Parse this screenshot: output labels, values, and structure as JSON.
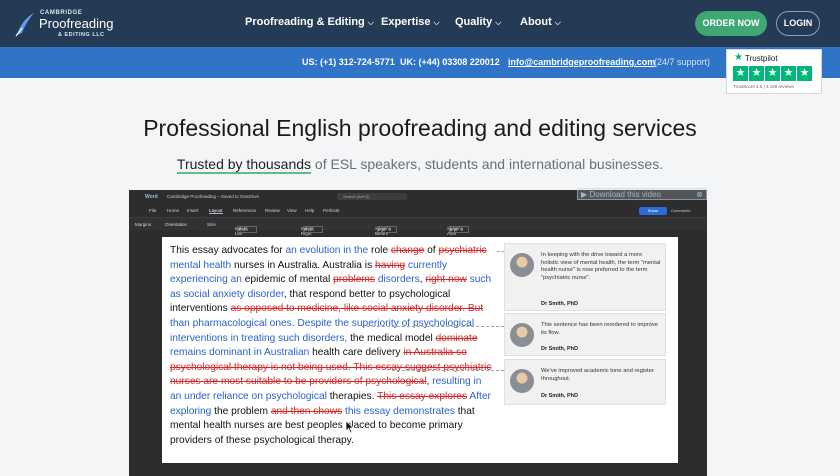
{
  "header": {
    "logo": {
      "top": "CAMBRIDGE",
      "main": "Proofreading",
      "bottom": "& EDITING LLC"
    },
    "nav": [
      {
        "label": "Proofreading & Editing"
      },
      {
        "label": "Expertise"
      },
      {
        "label": "Quality"
      },
      {
        "label": "About"
      }
    ],
    "order_label": "ORDER NOW",
    "login_label": "LOGIN"
  },
  "contact": {
    "us": "US: (+1) 312-724-5771",
    "uk": "UK: (+44) 03308 220012",
    "email": "info@cambridgeproofreading.com",
    "availability": "(24/7 support)"
  },
  "trustpilot": {
    "name": "Trustpilot",
    "score": "TrustScore 4.5 | 3,158 reviews",
    "stars": 5
  },
  "hero": {
    "title": "Professional English proofreading and editing services",
    "subtitle_highlight": "Trusted by thousands",
    "subtitle_rest": " of ESL speakers, students and international businesses."
  },
  "video": {
    "download_label": "Download this video",
    "app": "Word",
    "doc_title": "Cambridge Proofreading – Saved to OneDrive",
    "search_placeholder": "Search (Alt+Q)",
    "menu": [
      "File",
      "Home",
      "Insert",
      "Layout",
      "References",
      "Review",
      "View",
      "Help",
      "Perfectit"
    ],
    "active_menu": "Layout",
    "share_label": "Share",
    "comments_label": "Comments",
    "ribbon": {
      "margins": "Margins",
      "orientation": "Orientation",
      "size": "Size",
      "indent_left": "Indent Left",
      "indent_left_val": "0 cm",
      "indent_right": "Indent Right",
      "indent_right_val": "0 cm",
      "spacing_before": "Spacing Before",
      "spacing_before_val": "0 pt",
      "spacing_after": "Spacing After",
      "spacing_after_val": "8 pt"
    },
    "document": [
      {
        "t": "n",
        "s": "This essay advocates for "
      },
      {
        "t": "i",
        "s": "an evolution in the"
      },
      {
        "t": "n",
        "s": " role "
      },
      {
        "t": "d",
        "s": "change"
      },
      {
        "t": "n",
        "s": " of "
      },
      {
        "t": "d",
        "s": "psychiatric"
      },
      {
        "t": "n",
        "s": " "
      },
      {
        "t": "i",
        "s": "mental health"
      },
      {
        "t": "n",
        "s": " nurses in Australia. Australia is "
      },
      {
        "t": "d",
        "s": "having"
      },
      {
        "t": "n",
        "s": " "
      },
      {
        "t": "i",
        "s": "currently experiencing an"
      },
      {
        "t": "n",
        "s": " epidemic of mental "
      },
      {
        "t": "d",
        "s": "problems"
      },
      {
        "t": "n",
        "s": " "
      },
      {
        "t": "i",
        "s": "disorders"
      },
      {
        "t": "n",
        "s": ", "
      },
      {
        "t": "d",
        "s": "right now"
      },
      {
        "t": "n",
        "s": " "
      },
      {
        "t": "i",
        "s": "such as social anxiety disorder"
      },
      {
        "t": "n",
        "s": ", that respond better to psychological interventions "
      },
      {
        "t": "d",
        "s": "as opposed to medicine, like social anxiety disorder. But"
      },
      {
        "t": "n",
        "s": " "
      },
      {
        "t": "i",
        "s": "than pharmacological ones. Despite the superiority of psychological interventions in treating such disorders,"
      },
      {
        "t": "n",
        "s": " the medical model "
      },
      {
        "t": "d",
        "s": "dominate"
      },
      {
        "t": "n",
        "s": " "
      },
      {
        "t": "i",
        "s": "remains dominant in Australian"
      },
      {
        "t": "n",
        "s": " health care delivery "
      },
      {
        "t": "d",
        "s": "in Australia so psychological therapy is not being used. This essay suggest psychiatric nurses are most suitable to be providers of psychological"
      },
      {
        "t": "n",
        "s": ", "
      },
      {
        "t": "i",
        "s": "resulting in an under reliance on psychological"
      },
      {
        "t": "n",
        "s": " therapies. "
      },
      {
        "t": "d",
        "s": "This essay explores"
      },
      {
        "t": "n",
        "s": " "
      },
      {
        "t": "i",
        "s": "After exploring"
      },
      {
        "t": "n",
        "s": " the problem "
      },
      {
        "t": "d",
        "s": "and then shows"
      },
      {
        "t": "n",
        "s": " "
      },
      {
        "t": "i",
        "s": "this essay demonstrates"
      },
      {
        "t": "n",
        "s": " that mental health nurses are best peoples placed to become primary providers of these psychological therapy."
      }
    ],
    "comments": [
      {
        "text": "In keeping with the drive toward a more holistic view of mental health, the term \"mental health nurse\" is now preferred to the term \"psychiatric nurse\".",
        "author": "Dr Smith, PhD"
      },
      {
        "text": "This sentence has been reordered to improve its flow.",
        "author": "Dr Smith, PhD"
      },
      {
        "text": "We've improved academic tone and register throughout.",
        "author": "Dr Smith, PhD"
      }
    ]
  },
  "colors": {
    "navbar": "#243a55",
    "contact_bar": "#2f74c7",
    "order_button": "#3fa772",
    "insert": "#2a62c9",
    "delete": "#d22a2a",
    "trustpilot": "#00b67a"
  }
}
